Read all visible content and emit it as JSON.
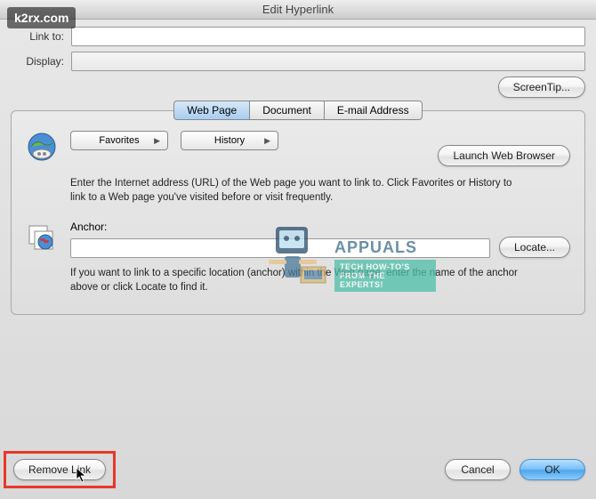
{
  "watermark": "k2rx.com",
  "window": {
    "title": "Edit Hyperlink"
  },
  "fields": {
    "linkto_label": "Link to:",
    "display_label": "Display:",
    "linkto_value": "",
    "display_value": ""
  },
  "buttons": {
    "screentip": "ScreenTip...",
    "launch_browser": "Launch Web Browser",
    "locate": "Locate...",
    "remove_link": "Remove Link",
    "cancel": "Cancel",
    "ok": "OK"
  },
  "tabs": {
    "web_page": "Web Page",
    "document": "Document",
    "email": "E-mail Address"
  },
  "popups": {
    "favorites": "Favorites",
    "history": "History"
  },
  "help": {
    "url_help": "Enter the Internet address (URL) of the Web page you want to link to. Click Favorites or History to link to a Web page you've visited before or visit frequently.",
    "anchor_label": "Anchor:",
    "anchor_help": "If you want to link to a specific location (anchor) within the Web page, enter the name of the anchor above or click Locate to find it."
  },
  "logo": {
    "brand": "APPUALS",
    "tagline": "TECH HOW-TO'S FROM THE EXPERTS!"
  }
}
